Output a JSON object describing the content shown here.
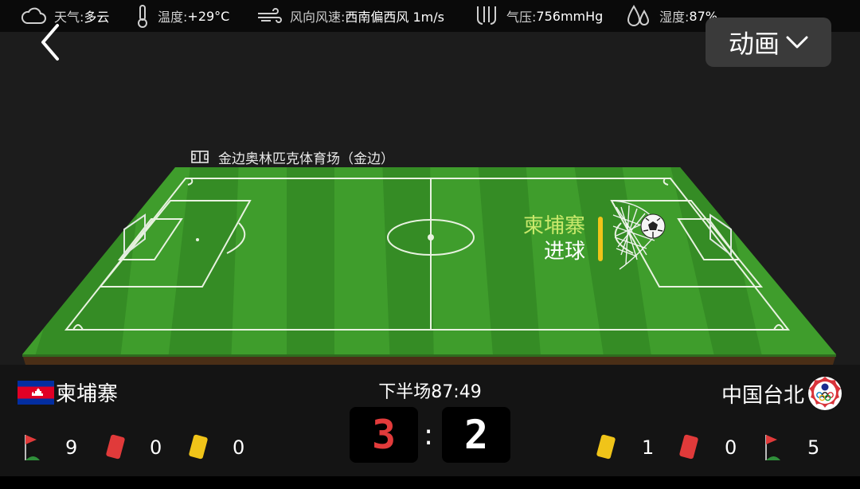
{
  "weather": {
    "condition": "天气:",
    "condition_value": "多云",
    "temperature": "温度:",
    "temperature_value": "+29°C",
    "wind": "风向风速:",
    "wind_value": "西南偏西风 1m/s",
    "pressure": "气压:",
    "pressure_value": "756mmHg",
    "humidity": "湿度:",
    "humidity_value": "87%"
  },
  "header": {
    "animation_label": "动画"
  },
  "stadium": {
    "name": "金边奥林匹克体育场（金边）"
  },
  "event": {
    "team": "柬埔寨",
    "action": "进球"
  },
  "match": {
    "period_time": "下半场87:49",
    "home": {
      "name": "柬埔寨",
      "score": "3",
      "corners": "9",
      "red_cards": "0",
      "yellow_cards": "0"
    },
    "away": {
      "name": "中国台北",
      "score": "2",
      "corners": "5",
      "red_cards": "0",
      "yellow_cards": "1"
    }
  },
  "colors": {
    "accent_goal_team": "#c9e86b",
    "home_score": "#e23b3b",
    "yellow_card": "#f0c419",
    "red_card": "#e03a3a",
    "pitch": "#3a9a2a"
  }
}
